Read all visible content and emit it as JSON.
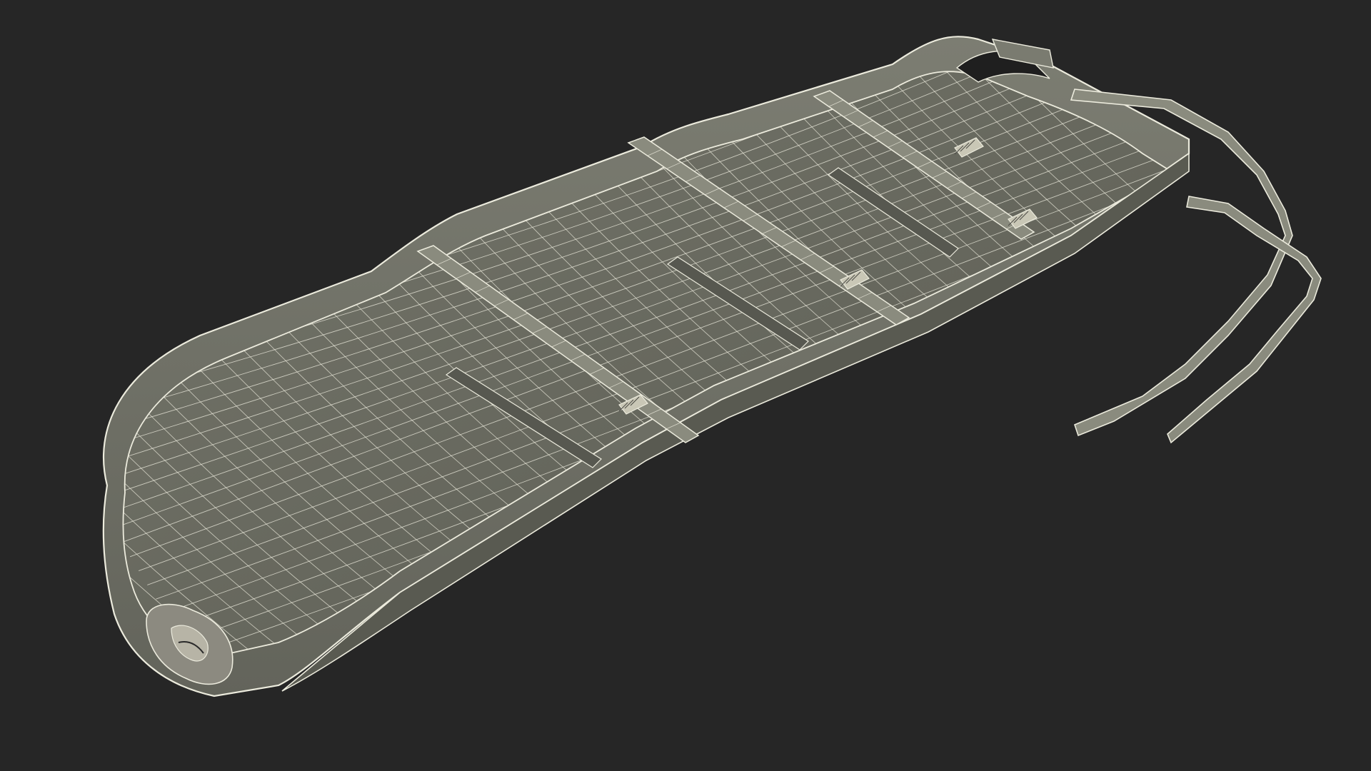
{
  "scene": {
    "subject": "rescue-sled",
    "render_style": "wireframe",
    "background_color": "#262626",
    "surface_inner_color": "#6b6c62",
    "surface_shaded_color": "#575850",
    "surface_outer_color": "#7a7b70",
    "wire_color": "#ecebdd",
    "strap_color": "#8a8b7e",
    "buckle_color": "#c9c7b6"
  }
}
